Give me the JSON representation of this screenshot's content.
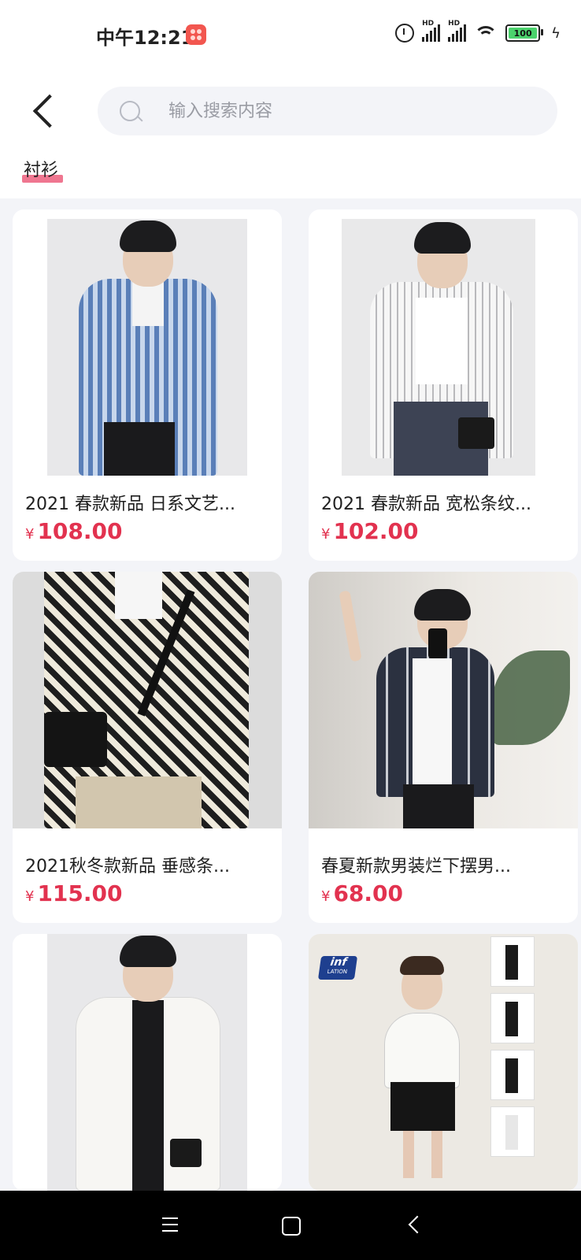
{
  "status_bar": {
    "time": "中午12:21",
    "hd_1": "HD",
    "hd_2": "HD",
    "battery_level": "100"
  },
  "header": {
    "search": {
      "placeholder": "输入搜索内容"
    },
    "active_category": "衬衫",
    "accent_color": "#ef7690"
  },
  "products": [
    {
      "name": "2021 春款新品 日系文艺...",
      "currency": "¥",
      "price": "108.00",
      "icon": "shirt-photo-blue-stripe"
    },
    {
      "name": "2021 春款新品 宽松条纹...",
      "currency": "¥",
      "price": "102.00",
      "icon": "shirt-photo-white-stripe"
    },
    {
      "name": "2021秋冬款新品 垂感条...",
      "currency": "¥",
      "price": "115.00",
      "icon": "shirt-photo-houndstooth"
    },
    {
      "name": "春夏新款男装烂下摆男...",
      "currency": "¥",
      "price": "68.00",
      "icon": "shirt-photo-plaid"
    },
    {
      "name": "",
      "currency": "",
      "price": "",
      "icon": "shirt-photo-white-jacket"
    },
    {
      "name": "",
      "currency": "",
      "price": "",
      "icon": "shirt-photo-white-short-sleeve"
    }
  ],
  "photo_texts": {
    "brand_logo_line1": "inf",
    "brand_logo_line2": "LATION"
  },
  "price_color": "#e2324f"
}
